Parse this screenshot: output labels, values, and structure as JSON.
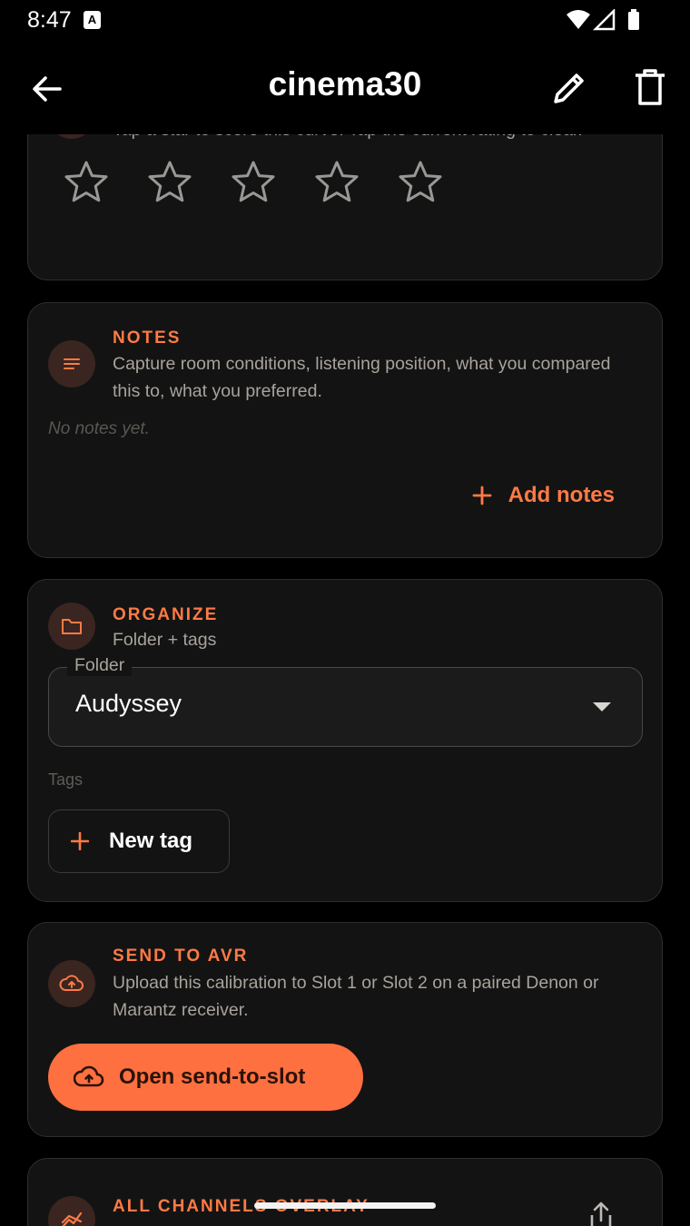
{
  "status_bar": {
    "time": "8:47",
    "notification_icon": "A"
  },
  "app_bar": {
    "title": "cinema30",
    "back_icon": "arrow-left-icon",
    "edit_icon": "pencil-icon",
    "delete_icon": "trash-icon"
  },
  "rating": {
    "description": "Tap a star to score this curve. Tap the current rating to clear.",
    "stars_max": 5,
    "stars_filled": 0
  },
  "notes": {
    "title": "NOTES",
    "description": "Capture room conditions, listening position, what you compared this to, what you preferred.",
    "empty_text": "No notes yet.",
    "add_label": "Add notes"
  },
  "organize": {
    "title": "ORGANIZE",
    "description": "Folder + tags",
    "folder_label": "Folder",
    "folder_value": "Audyssey",
    "tags_label": "Tags",
    "new_tag_label": "New tag"
  },
  "send": {
    "title": "SEND TO AVR",
    "description": "Upload this calibration to Slot 1 or Slot 2 on a paired Denon or Marantz receiver.",
    "button_label": "Open send-to-slot"
  },
  "overlay": {
    "title": "ALL CHANNELS OVERLAY"
  },
  "colors": {
    "accent": "#ff7a45",
    "button_fill": "#ff7040",
    "card": "#131313",
    "background": "#000000"
  }
}
